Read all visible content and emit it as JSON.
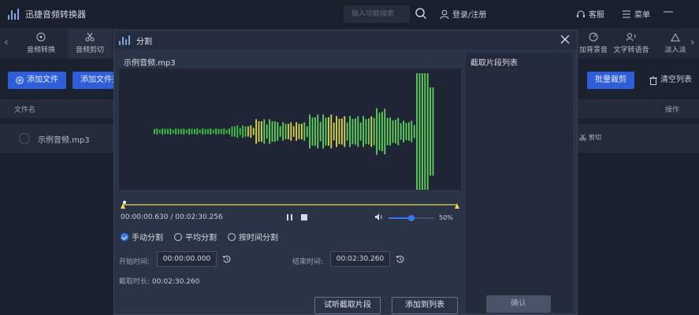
{
  "app": {
    "title": "迅捷音频转换器"
  },
  "header": {
    "search_placeholder": "输入功能搜索",
    "login": "登录/注册",
    "service": "客服",
    "menu": "菜单"
  },
  "toolbar": {
    "tools": [
      {
        "label": "音频转换",
        "icon": "convert-icon"
      },
      {
        "label": "音频剪切",
        "icon": "scissors-icon"
      },
      {
        "label": "加背景音",
        "icon": "background-music-icon"
      },
      {
        "label": "文字转语音",
        "icon": "text-to-speech-icon"
      },
      {
        "label": "淡入淡",
        "icon": "fade-icon"
      }
    ]
  },
  "actions": {
    "add_file": "添加文件",
    "add_folder": "添加文件夹",
    "batch_cut": "批量裁剪",
    "clear_list": "清空列表"
  },
  "table": {
    "col_filename": "文件名",
    "col_action": "操作",
    "rows": [
      {
        "name": "示例音频.mp3",
        "action": "剪切"
      }
    ]
  },
  "dialog": {
    "title": "分割",
    "file_name": "示例音频.mp3",
    "segment_list_title": "截取片段列表",
    "time_current": "00:00:00.630",
    "time_total": "00:02:30.256",
    "volume_percent": 50,
    "volume_label": "50%",
    "modes": [
      {
        "label": "手动分割",
        "selected": true
      },
      {
        "label": "平均分割",
        "selected": false
      },
      {
        "label": "按时间分割",
        "selected": false
      }
    ],
    "start_label": "开始时间:",
    "start_value": "00:00:00.000",
    "end_label": "结束时间:",
    "end_value": "00:02:30.260",
    "duration_label": "截取时长:",
    "duration_value": "00:02:30.260",
    "preview_button": "试听截取片段",
    "add_button": "添加到列表",
    "confirm_button": "确认"
  },
  "colors": {
    "accent": "#2e5fd8",
    "wave_green": "#3ec84a",
    "wave_yellow": "#d9d84a",
    "trim_line": "#f1d54a"
  }
}
